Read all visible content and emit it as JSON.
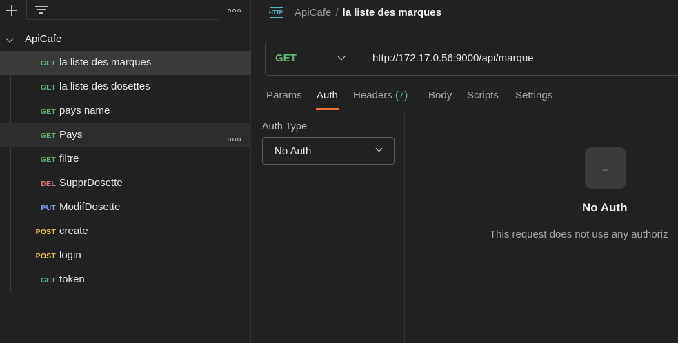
{
  "sidebar": {
    "collection": {
      "name": "ApiCafe"
    },
    "requests": [
      {
        "method": "GET",
        "name": "la liste des marques"
      },
      {
        "method": "GET",
        "name": "la liste des dosettes"
      },
      {
        "method": "GET",
        "name": "pays name"
      },
      {
        "method": "GET",
        "name": "Pays"
      },
      {
        "method": "GET",
        "name": "filtre"
      },
      {
        "method": "DEL",
        "name": "SupprDosette"
      },
      {
        "method": "PUT",
        "name": "ModifDosette"
      },
      {
        "method": "POST",
        "name": "create"
      },
      {
        "method": "POST",
        "name": "login"
      },
      {
        "method": "GET",
        "name": "token"
      }
    ]
  },
  "header": {
    "icon": "http-icon",
    "breadcrumb_collection": "ApiCafe",
    "breadcrumb_separator": "/",
    "breadcrumb_request": "la liste des marques"
  },
  "request": {
    "method": "GET",
    "url": "http://172.17.0.56:9000/api/marque"
  },
  "tabs": {
    "params": "Params",
    "auth": "Auth",
    "headers": "Headers",
    "headers_count": "(7)",
    "body": "Body",
    "scripts": "Scripts",
    "settings": "Settings",
    "active": "Auth"
  },
  "auth": {
    "type_label": "Auth Type",
    "selected": "No Auth",
    "empty_icon_glyph": "–",
    "empty_title": "No Auth",
    "empty_description": "This request does not use any authoriz"
  },
  "colors": {
    "get": "#5fb87a",
    "del": "#e07a7a",
    "put": "#7aa3e8",
    "post": "#e8c24a",
    "accent": "#e8703a"
  }
}
